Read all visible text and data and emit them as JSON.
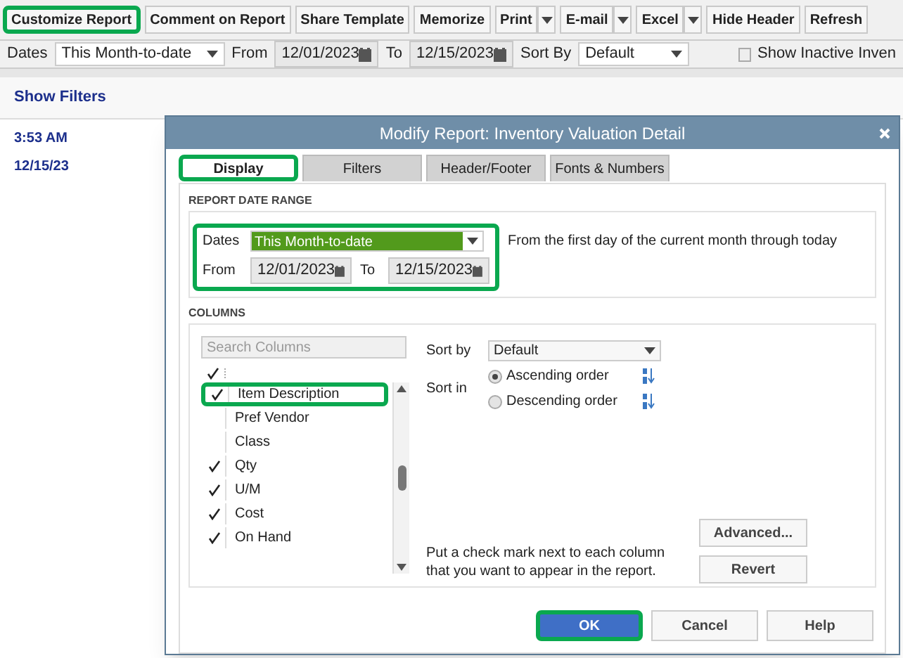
{
  "toolbar": {
    "buttons": [
      {
        "label": "Customize Report",
        "kind": "plain",
        "highlighted": true
      },
      {
        "label": "Comment on Report",
        "kind": "plain",
        "highlighted": false
      },
      {
        "label": "Share Template",
        "kind": "plain",
        "highlighted": false
      },
      {
        "label": "Memorize",
        "kind": "plain",
        "highlighted": false
      },
      {
        "label": "Print",
        "kind": "split",
        "highlighted": false
      },
      {
        "label": "E-mail",
        "kind": "split",
        "highlighted": false
      },
      {
        "label": "Excel",
        "kind": "split",
        "highlighted": false
      },
      {
        "label": "Hide Header",
        "kind": "plain",
        "highlighted": false
      },
      {
        "label": "Refresh",
        "kind": "plain",
        "highlighted": false
      }
    ]
  },
  "filter_bar": {
    "dates_label": "Dates",
    "dates_value": "This Month-to-date",
    "from_label": "From",
    "from_value": "12/01/2023",
    "to_label": "To",
    "to_value": "12/15/2023",
    "sort_label": "Sort By",
    "sort_value": "Default",
    "show_inactive": {
      "label": "Show Inactive Inven",
      "checked": false
    }
  },
  "report": {
    "show_filters": "Show Filters",
    "time": "3:53 AM",
    "date": "12/15/23"
  },
  "dialog": {
    "title": "Modify Report: Inventory Valuation Detail",
    "tabs": [
      {
        "label": "Display",
        "selected": true,
        "highlighted": true
      },
      {
        "label": "Filters",
        "selected": false,
        "highlighted": false
      },
      {
        "label": "Header/Footer",
        "selected": false,
        "highlighted": false
      },
      {
        "label": "Fonts & Numbers",
        "selected": false,
        "highlighted": false
      }
    ],
    "date_range": {
      "heading": "REPORT DATE RANGE",
      "dates_label": "Dates",
      "dates_value": "This Month-to-date",
      "from_label": "From",
      "from_value": "12/01/2023",
      "to_label": "To",
      "to_value": "12/15/2023",
      "description": "From the first day of the current month through today",
      "highlighted": true
    },
    "columns": {
      "heading": "COLUMNS",
      "search": {
        "placeholder": "Search Columns"
      },
      "items": [
        {
          "kind": "partial",
          "checked": true,
          "highlighted": false
        },
        {
          "kind": "row",
          "label": "Item Description",
          "checked": true,
          "highlighted": true
        },
        {
          "kind": "row",
          "label": "Pref Vendor",
          "checked": false,
          "highlighted": false
        },
        {
          "kind": "row",
          "label": "Class",
          "checked": false,
          "highlighted": false
        },
        {
          "kind": "row",
          "label": "Qty",
          "checked": true,
          "highlighted": false
        },
        {
          "kind": "row",
          "label": "U/M",
          "checked": true,
          "highlighted": false
        },
        {
          "kind": "row",
          "label": "Cost",
          "checked": true,
          "highlighted": false
        },
        {
          "kind": "row",
          "label": "On Hand",
          "checked": true,
          "highlighted": false
        }
      ],
      "sort_by_label": "Sort by",
      "sort_by_value": "Default",
      "sort_in_label": "Sort in",
      "sort_orders": [
        {
          "label": "Ascending order",
          "selected": true
        },
        {
          "label": "Descending order",
          "selected": false
        }
      ],
      "hint": "Put a check mark next to each column that you want to appear in the report."
    },
    "side_buttons": [
      "Advanced...",
      "Revert"
    ],
    "footer_buttons": [
      {
        "label": "OK",
        "kind": "primary",
        "highlighted": true
      },
      {
        "label": "Cancel",
        "kind": "plain",
        "highlighted": false
      },
      {
        "label": "Help",
        "kind": "plain",
        "highlighted": false
      }
    ]
  }
}
